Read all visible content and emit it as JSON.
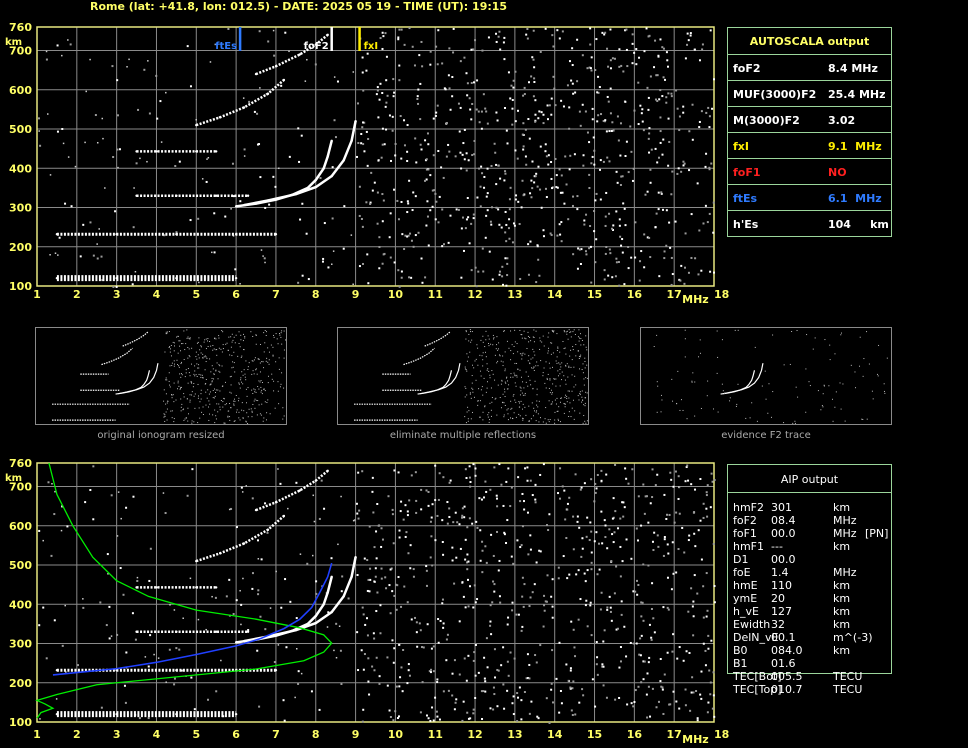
{
  "header": {
    "title": "Rome (lat: +41.8, lon: 012.5) - DATE: 2025 05 19 - TIME (UT): 19:15"
  },
  "colors": {
    "grid": "#8a8a8a",
    "frame": "#e8e880",
    "fxI": "#ffee00",
    "ftEs": "#2f7bff",
    "foF1": "#ff2020",
    "profile": "#00ee00",
    "aip_trace": "#2040ff"
  },
  "chart_data": [
    {
      "type": "scatter",
      "title": "",
      "xlabel": "MHz",
      "ylabel": "km",
      "xlim": [
        1,
        18
      ],
      "ylim": [
        100,
        760
      ],
      "x_ticks": [
        "1",
        "2",
        "3",
        "4",
        "5",
        "6",
        "7",
        "8",
        "9",
        "10",
        "11",
        "12",
        "13",
        "14",
        "15",
        "16",
        "17",
        "18"
      ],
      "y_ticks": [
        "100",
        "200",
        "300",
        "400",
        "500",
        "600",
        "700",
        "760"
      ],
      "markers": [
        {
          "name": "ftEs",
          "x": 6.1
        },
        {
          "name": "foF2",
          "x": 8.4
        },
        {
          "name": "fxI",
          "x": 9.1
        }
      ],
      "series": [
        {
          "values": [
            [
              6.0,
              303
            ],
            [
              6.5,
              310
            ],
            [
              7.0,
              320
            ],
            [
              7.4,
              332
            ],
            [
              7.8,
              350
            ],
            [
              8.0,
              370
            ],
            [
              8.2,
              400
            ],
            [
              8.3,
              430
            ],
            [
              8.4,
              470
            ]
          ]
        },
        {
          "values": [
            [
              6.2,
              306
            ],
            [
              6.8,
              318
            ],
            [
              7.5,
              334
            ],
            [
              8.0,
              352
            ],
            [
              8.4,
              380
            ],
            [
              8.7,
              420
            ],
            [
              8.9,
              470
            ],
            [
              9.0,
              520
            ]
          ]
        },
        {
          "values": [
            [
              1.5,
              120
            ],
            [
              3.0,
              120
            ],
            [
              4.5,
              120
            ],
            [
              6.0,
              120
            ]
          ]
        },
        {
          "values": [
            [
              1.5,
              232
            ],
            [
              3.0,
              232
            ],
            [
              4.5,
              232
            ],
            [
              6.0,
              232
            ],
            [
              7.0,
              232
            ]
          ]
        },
        {
          "values": [
            [
              3.5,
              330
            ],
            [
              4.5,
              330
            ],
            [
              5.5,
              330
            ],
            [
              6.3,
              330
            ]
          ]
        },
        {
          "values": [
            [
              3.5,
              443
            ],
            [
              4.0,
              443
            ],
            [
              5.0,
              443
            ],
            [
              5.5,
              443
            ]
          ]
        },
        {
          "values": [
            [
              5.0,
              510
            ],
            [
              5.6,
              530
            ],
            [
              6.2,
              555
            ],
            [
              6.8,
              590
            ],
            [
              7.2,
              625
            ]
          ]
        },
        {
          "values": [
            [
              6.5,
              640
            ],
            [
              7.0,
              660
            ],
            [
              7.6,
              690
            ],
            [
              8.0,
              715
            ],
            [
              8.3,
              740
            ]
          ]
        }
      ]
    },
    {
      "type": "line",
      "title": "",
      "xlabel": "MHz",
      "ylabel": "km",
      "xlim": [
        1,
        18
      ],
      "ylim": [
        100,
        760
      ],
      "x_ticks": [
        "1",
        "2",
        "3",
        "4",
        "5",
        "6",
        "7",
        "8",
        "9",
        "10",
        "11",
        "12",
        "13",
        "14",
        "15",
        "16",
        "17",
        "18"
      ],
      "y_ticks": [
        "100",
        "200",
        "300",
        "400",
        "500",
        "600",
        "700",
        "760"
      ],
      "series": [
        {
          "name": "profile",
          "values": [
            [
              1.0,
              110
            ],
            [
              1.1,
              124
            ],
            [
              1.4,
              135
            ],
            [
              1.2,
              146
            ],
            [
              1.0,
              155
            ],
            [
              1.5,
              170
            ],
            [
              2.5,
              195
            ],
            [
              4.5,
              215
            ],
            [
              6.5,
              235
            ],
            [
              7.7,
              256
            ],
            [
              8.2,
              278
            ],
            [
              8.4,
              301
            ],
            [
              8.2,
              322
            ],
            [
              7.6,
              340
            ],
            [
              6.5,
              362
            ],
            [
              5.0,
              385
            ],
            [
              3.8,
              420
            ],
            [
              3.0,
              460
            ],
            [
              2.4,
              520
            ],
            [
              1.9,
              600
            ],
            [
              1.5,
              680
            ],
            [
              1.3,
              760
            ]
          ]
        },
        {
          "name": "aip_trace",
          "values": [
            [
              1.4,
              220
            ],
            [
              2.0,
              226
            ],
            [
              3.0,
              236
            ],
            [
              4.0,
              252
            ],
            [
              5.0,
              272
            ],
            [
              6.0,
              294
            ],
            [
              6.6,
              312
            ],
            [
              7.2,
              338
            ],
            [
              7.6,
              362
            ],
            [
              7.9,
              392
            ],
            [
              8.1,
              430
            ],
            [
              8.3,
              470
            ],
            [
              8.4,
              505
            ]
          ]
        }
      ]
    }
  ],
  "autoscala": {
    "title": "AUTOSCALA output",
    "rows": [
      {
        "label": "foF2",
        "value": "8.4 MHz"
      },
      {
        "label": "MUF(3000)F2",
        "value": "25.4 MHz"
      },
      {
        "label": "M(3000)F2",
        "value": "3.02"
      },
      {
        "label": "fxI",
        "value": "9.1  MHz"
      },
      {
        "label": "foF1",
        "value": "NO"
      },
      {
        "label": "ftEs",
        "value": "6.1  MHz"
      },
      {
        "label": "h'Es",
        "value": "104     km"
      }
    ]
  },
  "thumbnails": [
    {
      "caption": "original ionogram resized"
    },
    {
      "caption": "eliminate multiple reflections"
    },
    {
      "caption": "evidence F2 trace"
    }
  ],
  "aip": {
    "title": "AIP output",
    "rows": [
      {
        "param": "hmF2",
        "value": "301",
        "unit": "km",
        "flag": ""
      },
      {
        "param": "foF2",
        "value": "08.4",
        "unit": "MHz",
        "flag": ""
      },
      {
        "param": "foF1",
        "value": "00.0",
        "unit": "MHz",
        "flag": "[PN]"
      },
      {
        "param": "hmF1",
        "value": "---",
        "unit": "km",
        "flag": ""
      },
      {
        "param": "D1",
        "value": "00.0",
        "unit": "",
        "flag": ""
      },
      {
        "param": "foE",
        "value": "1.4",
        "unit": "MHz",
        "flag": ""
      },
      {
        "param": "hmE",
        "value": "110",
        "unit": "km",
        "flag": ""
      },
      {
        "param": "ymE",
        "value": "20",
        "unit": "km",
        "flag": ""
      },
      {
        "param": "h_vE",
        "value": "127",
        "unit": "km",
        "flag": ""
      },
      {
        "param": "Ewidth",
        "value": "32",
        "unit": "km",
        "flag": ""
      },
      {
        "param": "DelN_vE",
        "value": "00.1",
        "unit": "m^(-3)",
        "flag": ""
      },
      {
        "param": "B0",
        "value": "084.0",
        "unit": "km",
        "flag": ""
      },
      {
        "param": "B1",
        "value": "01.6",
        "unit": "",
        "flag": ""
      },
      {
        "param": "TEC[Bot]",
        "value": "005.5",
        "unit": "TECU",
        "flag": ""
      },
      {
        "param": "TEC[Top]",
        "value": "010.7",
        "unit": "TECU",
        "flag": ""
      }
    ]
  }
}
